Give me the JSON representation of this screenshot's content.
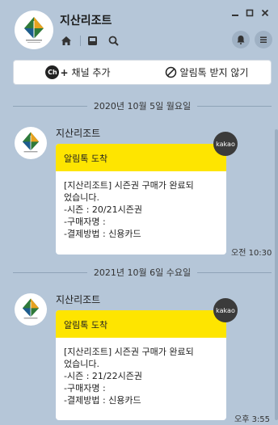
{
  "header": {
    "title": "지산리조트",
    "window_controls": [
      "minimize-icon",
      "maximize-icon",
      "close-icon"
    ],
    "left_icons": [
      "home-icon",
      "inbox-icon",
      "search-icon"
    ],
    "right_icons": [
      "bell-icon",
      "menu-icon"
    ]
  },
  "actions": {
    "add_channel": "채널 추가",
    "add_channel_badge": "Ch",
    "block_alerts": "알림톡 받지 않기"
  },
  "messages": [
    {
      "date": "2020년 10월 5일 월요일",
      "sender": "지산리조트",
      "header": "알림톡 도착",
      "badge": "kakao",
      "lines": [
        "[지산리조트] 시즌권 구매가 완료되",
        "었습니다.",
        "-시즌 : 20/21시즌권",
        "-구매자명 :",
        "-결제방법 : 신용카드"
      ],
      "time": "오전 10:30"
    },
    {
      "date": "2021년 10월 6일 수요일",
      "sender": "지산리조트",
      "header": "알림톡 도착",
      "badge": "kakao",
      "lines": [
        "[지산리조트] 시즌권 구매가 완료되",
        "었습니다.",
        "-시즌 : 21/22시즌권",
        "-구매자명 :",
        "-결제방법 : 신용카드"
      ],
      "time": "오후 3:55"
    }
  ],
  "colors": {
    "background": "#b5c6d8",
    "alert_header": "#fee500",
    "badge": "#3b3b3b"
  }
}
